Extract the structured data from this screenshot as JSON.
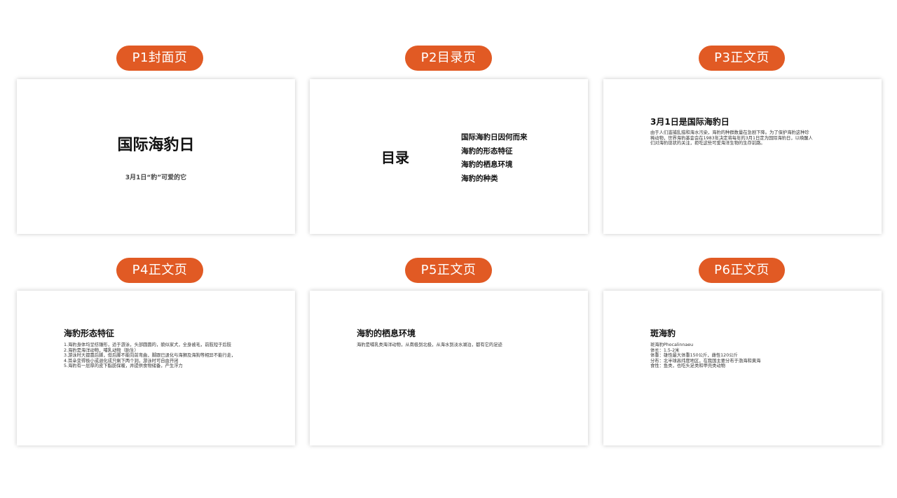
{
  "labels": {
    "p1": "P1封面页",
    "p2": "P2目录页",
    "p3": "P3正文页",
    "p4": "P4正文页",
    "p5": "P5正文页",
    "p6": "P6正文页"
  },
  "slide1": {
    "title": "国际海豹日",
    "subtitle": "3月1日“豹”可爱的它"
  },
  "slide2": {
    "title": "目录",
    "items": [
      "国际海豹日因何而来",
      "海豹的形态特征",
      "海豹的栖息环境",
      "海豹的种类"
    ]
  },
  "slide3": {
    "title": "3月1日是国际海豹日",
    "text": "由于人们滥捕乱猎和海水污染，海豹的种群数量在急剧下降。为了保护海豹这种珍稀动物，世界海豹基金会在1983年决定将每年的3月1日定为国际海豹日，以唤醒人们对海豹现状的关注，拒吃这些可爱海洋生物的生存前路。"
  },
  "slide4": {
    "title": "海豹形态特征",
    "lines": [
      "1.海豹身体均呈纺锤形，适于游泳，头部圆圆的，貌似家犬，全身被毛，前肢短于后肢",
      "2.海豹是海洋动物，哺乳动物（胎生）",
      "3.游泳时大都靠后脚，但后脚不能向前弯曲，脚跟已退化与海狮及海狗等相异不能行走，",
      "4.耳朵变得极小或退化成只剩下两个洞，游泳时可自由开闭",
      "5.海豹有一层厚的皮下脂肪保暖，并提供食物储备，产生浮力"
    ]
  },
  "slide5": {
    "title": "海豹的栖息环境",
    "text": "海豹是哺乳类海洋动物，从南极到北极，从海水到淡水湖泊，都有它的足迹"
  },
  "slide6": {
    "title": "斑海豹",
    "lines": [
      "斑海豹Phocalinnaeu",
      "体长：1.5-2米",
      "体重：雄性最大体重150公斤，雌性120公斤",
      "分布：北半球高纬度地区，在我国主要分布于渤海和黄海",
      "食性：鱼类，也吃头足类和甲壳类动物"
    ]
  }
}
